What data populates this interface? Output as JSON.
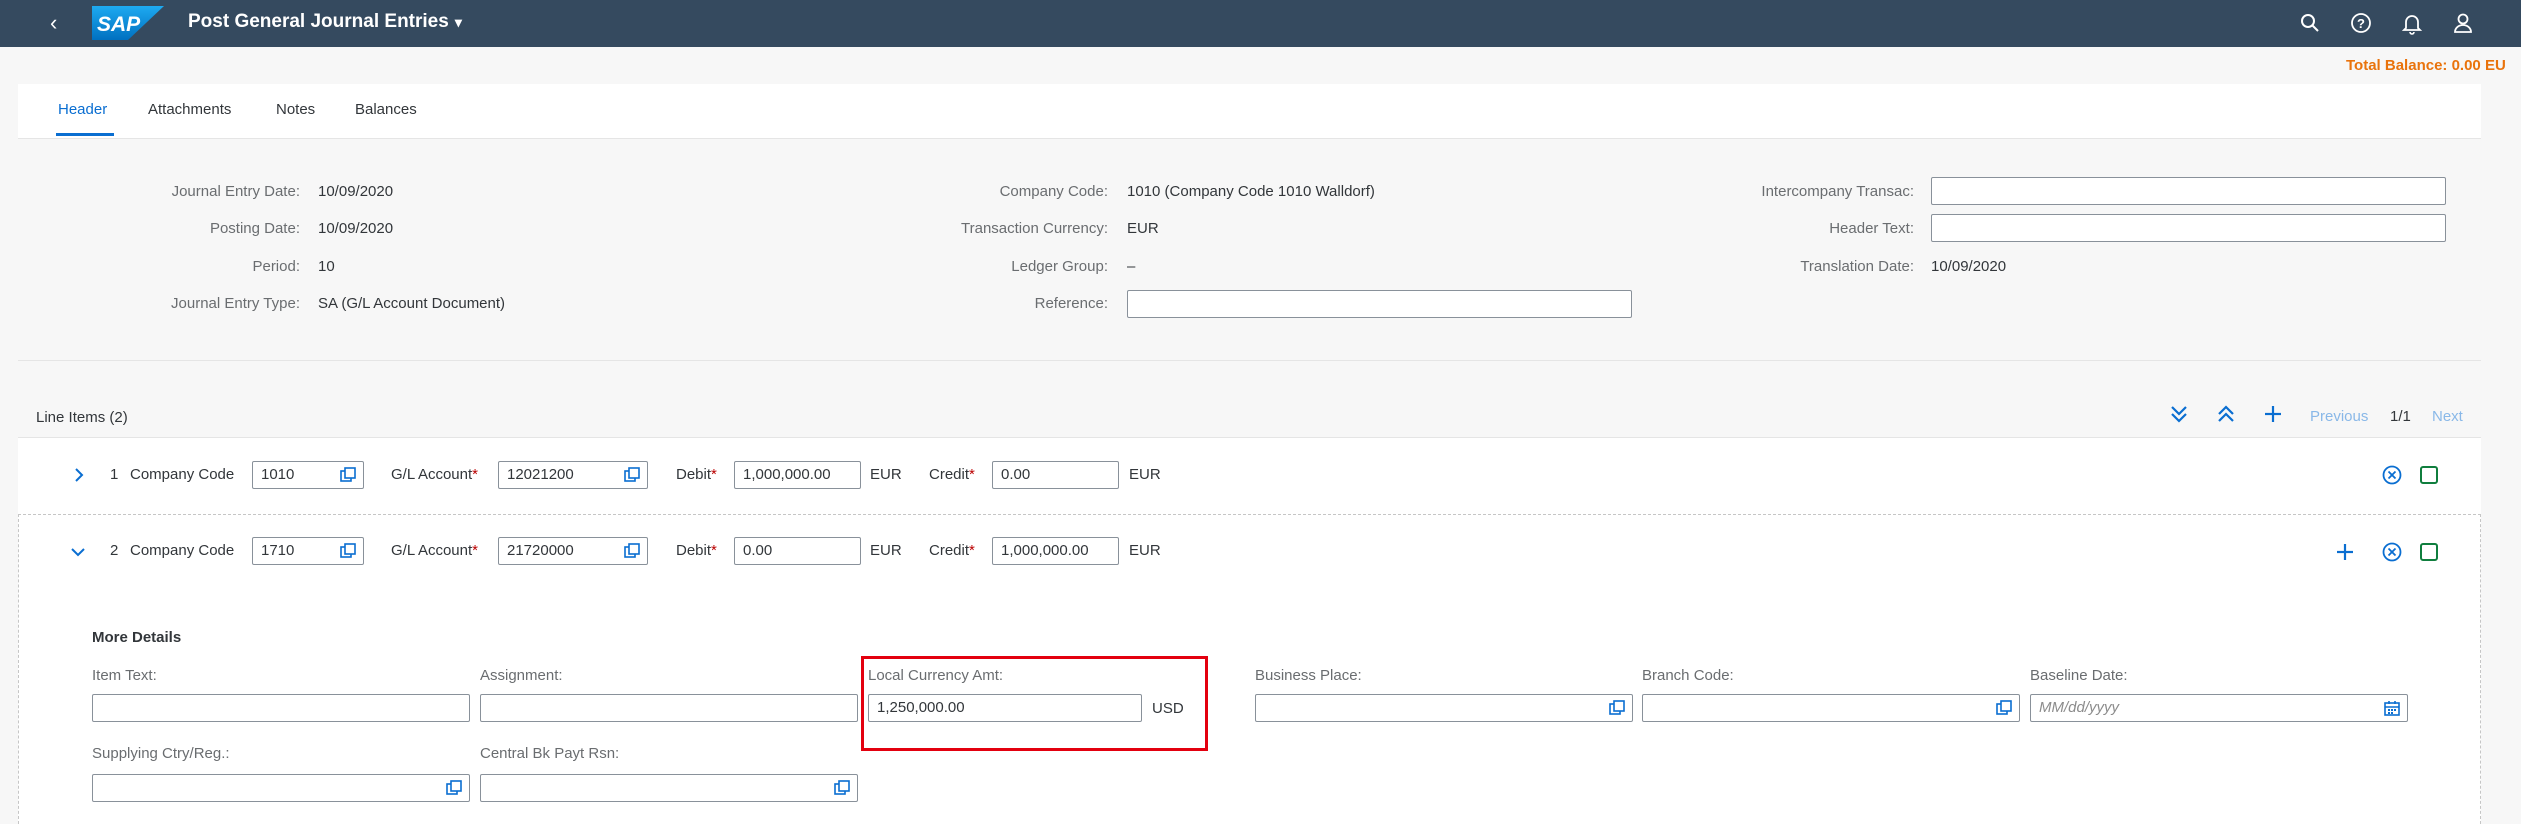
{
  "shell": {
    "back": "‹",
    "title": "Post General Journal Entries",
    "caret": "▾",
    "logo": "SAP",
    "icons": [
      "search-icon",
      "help-icon",
      "notifications-icon",
      "user-icon"
    ]
  },
  "total_balance": "Total Balance: 0.00 EU",
  "tabs": [
    "Header",
    "Attachments",
    "Notes",
    "Balances"
  ],
  "header": {
    "journal_entry_date_label": "Journal Entry Date:",
    "journal_entry_date": "10/09/2020",
    "posting_date_label": "Posting Date:",
    "posting_date": "10/09/2020",
    "period_label": "Period:",
    "period": "10",
    "journal_entry_type_label": "Journal Entry Type:",
    "journal_entry_type": "SA (G/L Account Document)",
    "company_code_label": "Company Code:",
    "company_code": "1010 (Company Code 1010 Walldorf)",
    "transaction_currency_label": "Transaction Currency:",
    "transaction_currency": "EUR",
    "ledger_group_label": "Ledger Group:",
    "ledger_group": "–",
    "reference_label": "Reference:",
    "reference": "",
    "intercompany_label": "Intercompany Transac:",
    "intercompany": "",
    "header_text_label": "Header Text:",
    "header_text": "",
    "translation_date_label": "Translation Date:",
    "translation_date": "10/09/2020"
  },
  "line_items": {
    "title": "Line Items (2)",
    "previous": "Previous",
    "page": "1/1",
    "next": "Next",
    "company_code_label": "Company Code",
    "gl_account_label": "G/L Account",
    "debit_label": "Debit",
    "credit_label": "Credit",
    "required": "*",
    "rows": [
      {
        "num": "1",
        "company_code": "1010",
        "gl_account": "12021200",
        "debit": "1,000,000.00",
        "debit_cur": "EUR",
        "credit": "0.00",
        "credit_cur": "EUR"
      },
      {
        "num": "2",
        "company_code": "1710",
        "gl_account": "21720000",
        "debit": "0.00",
        "debit_cur": "EUR",
        "credit": "1,000,000.00",
        "credit_cur": "EUR"
      }
    ]
  },
  "more_details": {
    "title": "More Details",
    "item_text_label": "Item Text:",
    "item_text": "",
    "assignment_label": "Assignment:",
    "assignment": "",
    "local_currency_label": "Local Currency Amt:",
    "local_currency": "1,250,000.00",
    "local_currency_unit": "USD",
    "business_place_label": "Business Place:",
    "business_place": "",
    "branch_code_label": "Branch Code:",
    "branch_code": "",
    "baseline_date_label": "Baseline Date:",
    "baseline_date_placeholder": "MM/dd/yyyy",
    "supplying_ctry_label": "Supplying Ctry/Reg.:",
    "supplying_ctry": "",
    "central_bank_label": "Central Bk Payt Rsn:",
    "central_bank": ""
  },
  "colors": {
    "shell": "#354a5f",
    "accent": "#0a6ed1",
    "balance": "#e9730c",
    "highlight": "#e3000f"
  }
}
